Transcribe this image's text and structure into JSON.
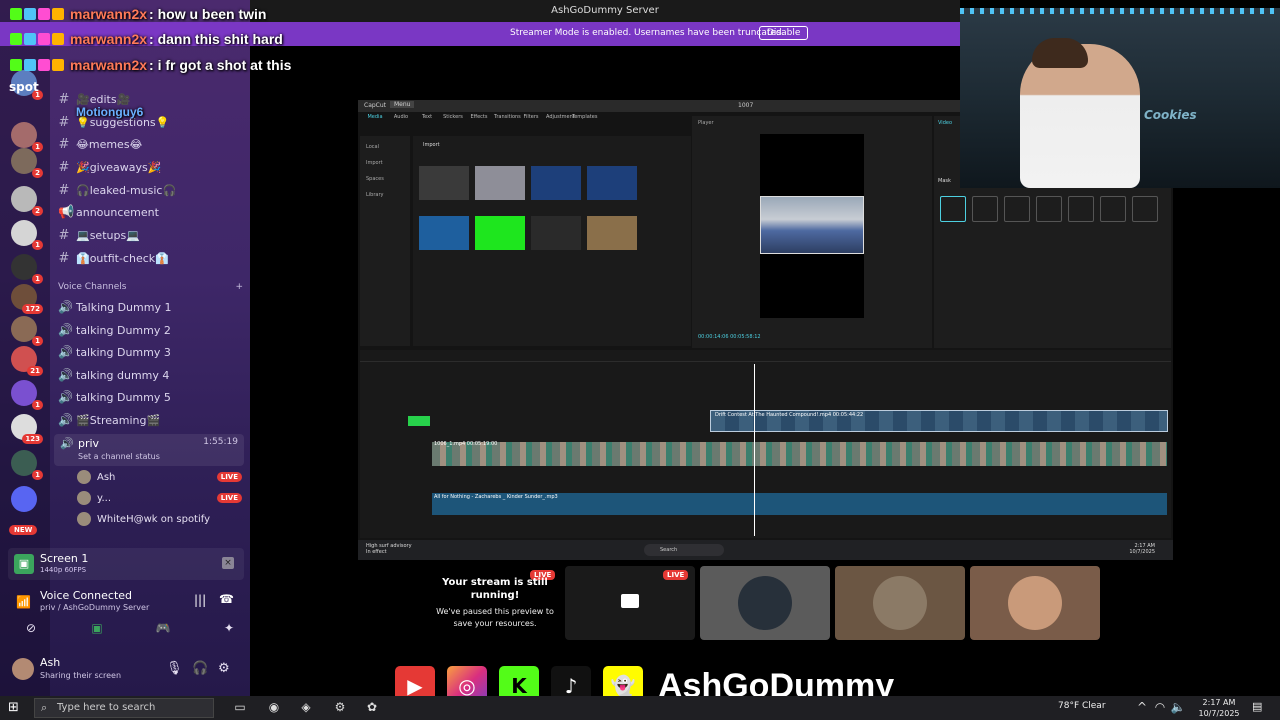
{
  "window": {
    "server_title": "AshGoDummy Server"
  },
  "banner": {
    "text": "Streamer Mode is enabled. Usernames have been truncated.",
    "button": "Disable"
  },
  "chat": [
    {
      "user": "marwann2x",
      "message": ": how u been twin"
    },
    {
      "user": "marwann2x",
      "message": ": dann this shit hard"
    },
    {
      "user": "marwann2x",
      "message": ": i fr got a shot at this"
    },
    {
      "user": "Motionguy6",
      "message": ""
    }
  ],
  "guilds": {
    "top_label": "spot",
    "new_badge": "NEW",
    "badges": [
      "1",
      "1",
      "2",
      "2",
      "1",
      "1",
      "172",
      "1",
      "21",
      "1",
      "123",
      "1"
    ]
  },
  "channels": {
    "text": [
      {
        "label": "🎥edits🎥"
      },
      {
        "label": "💡suggestions💡"
      },
      {
        "label": "😂memes😂"
      },
      {
        "label": "🎉giveaways🎉"
      },
      {
        "label": "🎧leaked-music🎧"
      },
      {
        "label": "announcement"
      },
      {
        "label": "💻setups💻"
      },
      {
        "label": "👔outfit-check👔"
      }
    ],
    "voice_header": "Voice Channels",
    "voice": [
      {
        "label": "Talking Dummy 1"
      },
      {
        "label": "talking Dummy 2"
      },
      {
        "label": "talking Dummy 3"
      },
      {
        "label": "talking dummy 4"
      },
      {
        "label": "talking Dummy 5"
      },
      {
        "label": "🎬Streaming🎬"
      }
    ],
    "priv": {
      "name": "priv",
      "time": "1:55:19",
      "status": "Set a channel status"
    },
    "priv_users": [
      {
        "name": "Ash",
        "live": "LIVE"
      },
      {
        "name": "y...",
        "live": "LIVE"
      },
      {
        "name": "WhiteH@wk on spotify",
        "live": ""
      }
    ]
  },
  "screen_share": {
    "title": "Screen 1",
    "sub": "1440p 60FPS"
  },
  "voice_connected": {
    "title": "Voice Connected",
    "sub": "priv / AshGoDummy Server"
  },
  "user": {
    "name": "Ash",
    "status": "Sharing their screen"
  },
  "capcut": {
    "logo": "CapCut",
    "menu": "Menu",
    "project": "1007",
    "tools": [
      "Media",
      "Audio",
      "Text",
      "Stickers",
      "Effects",
      "Transitions",
      "Filters",
      "Adjustment",
      "Templates"
    ],
    "side": [
      "Local",
      "Import",
      "Spaces",
      "Library"
    ],
    "import_label": "Import",
    "player_title": "Player",
    "player_time": "00:00:14:06   00:05:58:12",
    "props_tab": "Video",
    "mask_label": "Mask",
    "fx_clip": "Drift Contest At The Haunted Compound!.mp4  00:05:44:22",
    "main_clip": "1006_1.mp4  00:05:19:00",
    "audio_clip": "All for Nothing - Zacharebs _ Kinder Sunder_.mp3",
    "surf": "High surf advisory",
    "surf_sub": "In effect",
    "search": "Search",
    "clock_time": "2:17 AM",
    "clock_date": "10/7/2025"
  },
  "stream_paused": {
    "live": "LIVE",
    "title": "Your stream is still running!",
    "body": "We've paused this preview to save your resources."
  },
  "preview_live": "LIVE",
  "brand": {
    "name": "AshGoDummy"
  },
  "taskbar": {
    "search_placeholder": "Type here to search",
    "weather": "78°F  Clear",
    "time": "2:17 AM",
    "date": "10/7/2025"
  },
  "colors": {
    "banner": "#7a37c4",
    "live": "#e53935",
    "accent": "#4dd0e1"
  }
}
